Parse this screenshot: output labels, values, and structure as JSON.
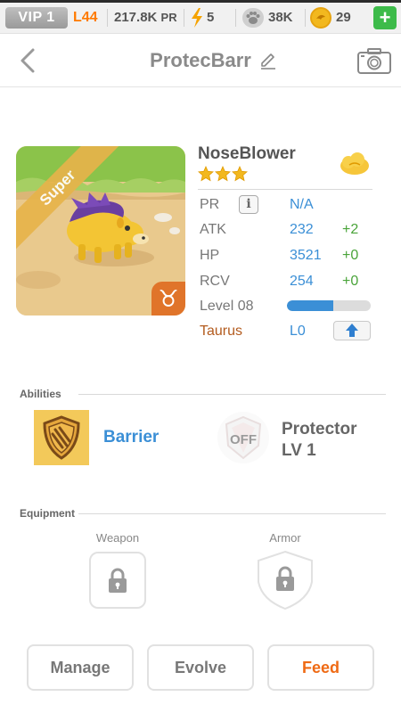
{
  "status_bar": {
    "vip": "VIP 1",
    "level": "L44",
    "pr": "217.8K",
    "pr_unit": "PR",
    "energy": "5",
    "food": "38K",
    "coins": "29",
    "add_label": "+"
  },
  "header": {
    "title": "ProtecBarr"
  },
  "pet": {
    "rarity": "Super",
    "species": "NoseBlower",
    "star_count": 3,
    "zodiac_symbol": "♉",
    "stats": {
      "pr_label": "PR",
      "pr_value": "N/A",
      "info_label": "i",
      "atk_label": "ATK",
      "atk_value": "232",
      "atk_bonus": "+2",
      "hp_label": "HP",
      "hp_value": "3521",
      "hp_bonus": "+0",
      "rcv_label": "RCV",
      "rcv_value": "254",
      "rcv_bonus": "+0",
      "level_label": "Level 08",
      "exp_progress": 0.55,
      "zodiac_name": "Taurus",
      "zodiac_level": "L0"
    }
  },
  "abilities": {
    "title": "Abilities",
    "first": {
      "name": "Barrier"
    },
    "second": {
      "name_line1": "Protector",
      "name_line2": "LV 1",
      "state": "OFF"
    }
  },
  "equipment": {
    "title": "Equipment",
    "weapon_label": "Weapon",
    "armor_label": "Armor"
  },
  "actions": {
    "manage": "Manage",
    "evolve": "Evolve",
    "feed": "Feed"
  },
  "colors": {
    "accent_blue": "#3b8fd6",
    "bonus_green": "#4aa43a",
    "feed_orange": "#ef6a14",
    "level_orange": "#ff7a00"
  }
}
